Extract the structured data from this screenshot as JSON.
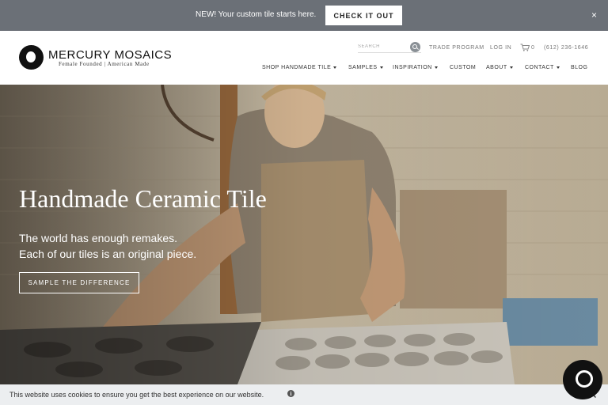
{
  "announcement": {
    "text": "NEW! Your custom tile starts here.",
    "button_label": "CHECK IT OUT",
    "close_glyph": "×"
  },
  "brand": {
    "name": "MERCURY MOSAICS",
    "tagline": "Female Founded | American Made"
  },
  "search": {
    "placeholder": "SEARCH",
    "icon": "search-icon"
  },
  "utility": {
    "trade_program": "TRADE PROGRAM",
    "log_in": "LOG IN",
    "cart_count": "0",
    "phone": "(612) 236-1646"
  },
  "nav": {
    "items": [
      {
        "label": "SHOP HANDMADE TILE",
        "dropdown": true
      },
      {
        "label": "SAMPLES",
        "dropdown": true
      },
      {
        "label": "INSPIRATION",
        "dropdown": true
      },
      {
        "label": "CUSTOM",
        "dropdown": false
      },
      {
        "label": "ABOUT",
        "dropdown": true
      },
      {
        "label": "CONTACT",
        "dropdown": true
      },
      {
        "label": "BLOG",
        "dropdown": false
      }
    ]
  },
  "hero": {
    "title": "Handmade Ceramic Tile",
    "subtitle_line1": "The world has enough remakes.",
    "subtitle_line2": "Each of our tiles is an original piece.",
    "cta_label": "SAMPLE THE DIFFERENCE"
  },
  "cookie": {
    "text": "This website uses cookies to ensure you get the best experience on our website.",
    "info_glyph": "i",
    "close_glyph": "✕"
  },
  "colors": {
    "announce_bg": "#6b7077",
    "cookie_bg": "#eceef0",
    "text_dark": "#333333"
  }
}
